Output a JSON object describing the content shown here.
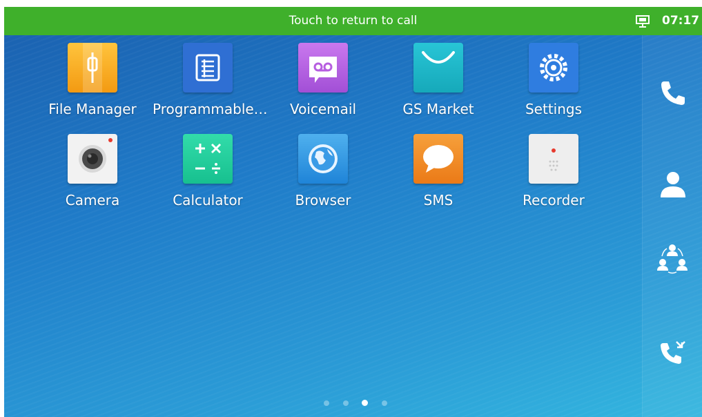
{
  "status_bar": {
    "call_banner": "Touch to return to call",
    "time": "07:17",
    "bg_color": "#3fb02b"
  },
  "apps": [
    {
      "label": "File Manager",
      "icon": "file-manager-icon",
      "color": "#f5a31b"
    },
    {
      "label": "Programmable…",
      "icon": "programmable-keys-icon",
      "color": "#2f6fd3"
    },
    {
      "label": "Voicemail",
      "icon": "voicemail-icon",
      "color": "#b65ee0"
    },
    {
      "label": "GS Market",
      "icon": "market-bag-icon",
      "color": "#1fb7c8"
    },
    {
      "label": "Settings",
      "icon": "gear-icon",
      "color": "#2f7de0"
    },
    {
      "label": "Camera",
      "icon": "camera-icon",
      "color": "#f2f2f2"
    },
    {
      "label": "Calculator",
      "icon": "calculator-icon",
      "color": "#1fcf9c"
    },
    {
      "label": "Browser",
      "icon": "globe-icon",
      "color": "#2b8fe0"
    },
    {
      "label": "SMS",
      "icon": "chat-bubble-icon",
      "color": "#f08a22"
    },
    {
      "label": "Recorder",
      "icon": "recorder-icon",
      "color": "#eeeeee"
    }
  ],
  "dock": [
    {
      "icon": "phone-icon"
    },
    {
      "icon": "contacts-icon"
    },
    {
      "icon": "conference-icon"
    },
    {
      "icon": "call-history-icon"
    }
  ],
  "pager": {
    "pages": 4,
    "current": 3
  }
}
